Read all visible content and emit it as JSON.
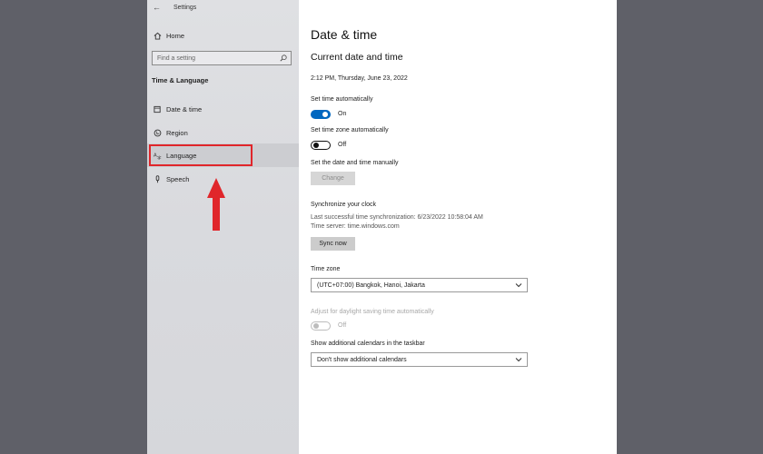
{
  "window": {
    "title": "Settings"
  },
  "sidebar": {
    "home_label": "Home",
    "search_placeholder": "Find a setting",
    "section_title": "Time & Language",
    "items": [
      {
        "label": "Date & time",
        "icon": "date-time-icon"
      },
      {
        "label": "Region",
        "icon": "globe-icon"
      },
      {
        "label": "Language",
        "icon": "language-icon"
      },
      {
        "label": "Speech",
        "icon": "microphone-icon"
      }
    ],
    "selected_item": "Language"
  },
  "annotation": {
    "highlight_color": "#e0262b",
    "arrow_color": "#e0262b"
  },
  "main": {
    "title": "Date & time",
    "current_section_title": "Current date and time",
    "current_datetime": "2:12 PM, Thursday, June 23, 2022",
    "set_time_auto": {
      "label": "Set time automatically",
      "state": "On"
    },
    "set_tz_auto": {
      "label": "Set time zone automatically",
      "state": "Off"
    },
    "manual": {
      "label": "Set the date and time manually",
      "button": "Change"
    },
    "sync": {
      "title": "Synchronize your clock",
      "last_sync": "Last successful time synchronization: 6/23/2022 10:58:04 AM",
      "server": "Time server: time.windows.com",
      "button": "Sync now"
    },
    "timezone": {
      "label": "Time zone",
      "value": "(UTC+07:00) Bangkok, Hanoi, Jakarta"
    },
    "dst": {
      "label": "Adjust for daylight saving time automatically",
      "state": "Off"
    },
    "calendars": {
      "label": "Show additional calendars in the taskbar",
      "value": "Don't show additional calendars"
    }
  },
  "colors": {
    "accent": "#0067c0",
    "backdrop": "#5f6068"
  }
}
